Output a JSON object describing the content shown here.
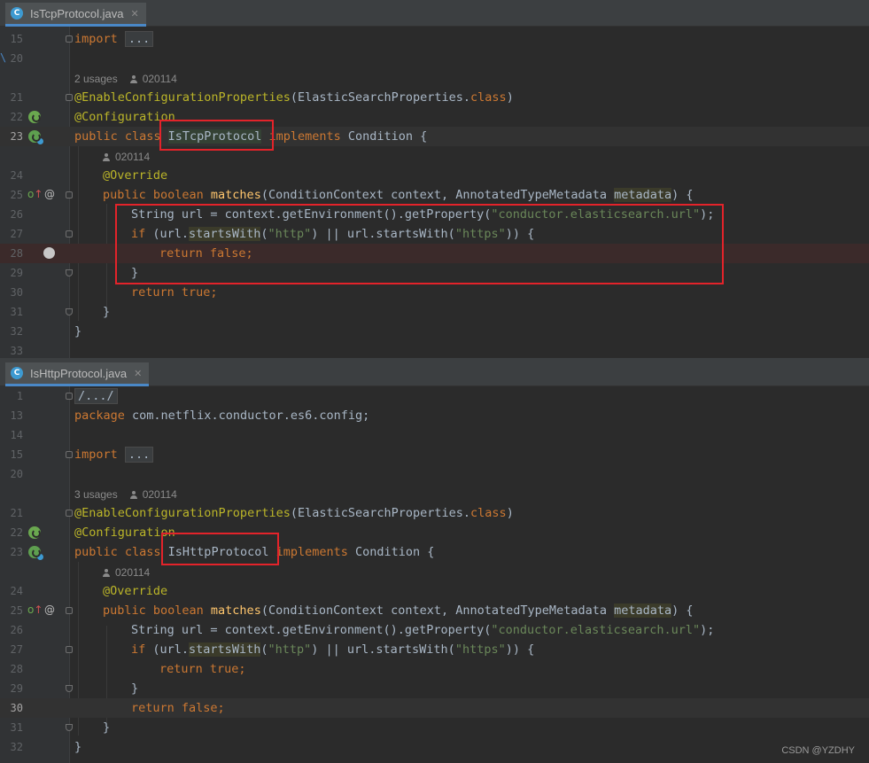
{
  "pane1": {
    "tab_label": "IsTcpProtocol.java",
    "tab_icon": "C",
    "usages": "2 usages",
    "author": "020114",
    "method_author": "020114",
    "lines": {
      "l15": "15",
      "l20": "20",
      "l21": "21",
      "l22": "22",
      "l23": "23",
      "l24": "24",
      "l25": "25",
      "l26": "26",
      "l27": "27",
      "l28": "28",
      "l29": "29",
      "l30": "30",
      "l31": "31",
      "l32": "32",
      "l33": "33"
    },
    "code": {
      "import_kw": "import",
      "import_fold": "...",
      "enable": "@EnableConfigurationProperties",
      "enable_arg": "(ElasticSearchProperties.",
      "enable_class": "class",
      "enable_close": ")",
      "config": "@Configuration",
      "public_class": "public class ",
      "class_name": "IsTcpProtocol",
      "implements": " implements ",
      "condition": "Condition {",
      "override": "@Override",
      "public_boolean": "public boolean ",
      "matches": "matches",
      "params_a": "(ConditionContext context, AnnotatedTypeMetadata ",
      "params_b": "metadata",
      "params_c": ") {",
      "url_a": "String url = context.getEnvironment().getProperty(",
      "url_str": "\"conductor.elasticsearch.url\"",
      "url_c": ");",
      "if_kw": "if",
      "if_a": " (url.",
      "starts": "startsWith",
      "if_b": "(",
      "http": "\"http\"",
      "if_c": ") || url.startsWith(",
      "https": "\"https\"",
      "if_d": ")) {",
      "ret_kw": "return ",
      "ret_val": "false;",
      "close": "}",
      "ret2_kw": "return ",
      "ret2_val": "true;",
      "close2": "}",
      "close3": "}"
    }
  },
  "pane2": {
    "tab_label": "IsHttpProtocol.java",
    "tab_icon": "C",
    "usages": "3 usages",
    "author": "020114",
    "method_author": "020114",
    "lines": {
      "l1": "1",
      "l13": "13",
      "l14": "14",
      "l15": "15",
      "l20": "20",
      "l21": "21",
      "l22": "22",
      "l23": "23",
      "l24": "24",
      "l25": "25",
      "l26": "26",
      "l27": "27",
      "l28": "28",
      "l29": "29",
      "l30": "30",
      "l31": "31",
      "l32": "32"
    },
    "code": {
      "comment_fold": "/.../",
      "package_kw": "package",
      "package_name": " com.netflix.conductor.es6.config;",
      "import_kw": "import",
      "import_fold": "...",
      "enable": "@EnableConfigurationProperties",
      "enable_arg": "(ElasticSearchProperties.",
      "enable_class": "class",
      "enable_close": ")",
      "config": "@Configuration",
      "public_class": "public class ",
      "class_name": "IsHttpProtocol",
      "implements": " implements ",
      "condition": "Condition {",
      "override": "@Override",
      "public_boolean": "public boolean ",
      "matches": "matches",
      "params_a": "(ConditionContext context, AnnotatedTypeMetadata ",
      "params_b": "metadata",
      "params_c": ") {",
      "url_a": "String url = context.getEnvironment().getProperty(",
      "url_str": "\"conductor.elasticsearch.url\"",
      "url_c": ");",
      "if_kw": "if",
      "if_a": " (url.",
      "starts": "startsWith",
      "if_b": "(",
      "http": "\"http\"",
      "if_c": ") || url.startsWith(",
      "https": "\"https\"",
      "if_d": ")) {",
      "ret_kw": "return ",
      "ret_val": "true;",
      "close": "}",
      "ret2_kw": "return ",
      "ret2_val": "false;",
      "close2": "}",
      "close3": "}"
    }
  },
  "icons": {
    "tab": "java-class-icon",
    "spring_config": "spring-configuration-icon",
    "spring_bean": "spring-bean-icon",
    "override": "implements-method-icon",
    "at": "annotation-icon",
    "breakpoint": "breakpoint-icon",
    "person": "author-icon"
  },
  "colors": {
    "background": "#2b2b2b",
    "keyword": "#cc7832",
    "annotation": "#bbb529",
    "string": "#6a8759",
    "method": "#ffc66d",
    "text": "#a9b7c6",
    "highlight_box": "#e3232a"
  },
  "watermark": "CSDN @YZDHY"
}
